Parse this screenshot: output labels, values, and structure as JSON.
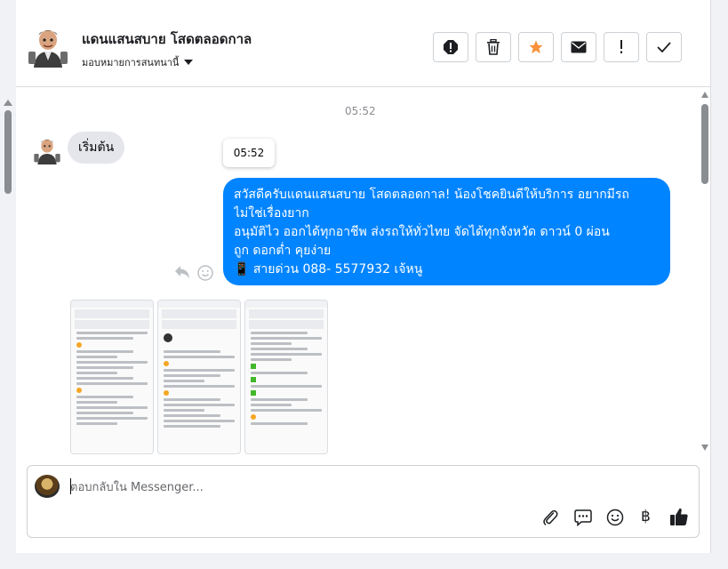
{
  "header": {
    "title": "แดนแสนสบาย โสดตลอดกาล",
    "assign_label": "มอบหมายการสนทนานี้",
    "actions": [
      {
        "name": "report-spam-button",
        "icon": "alert-octagon-icon"
      },
      {
        "name": "delete-button",
        "icon": "trash-icon"
      },
      {
        "name": "star-button",
        "icon": "star-icon"
      },
      {
        "name": "mark-unread-button",
        "icon": "envelope-icon"
      },
      {
        "name": "follow-up-button",
        "icon": "exclamation-icon"
      },
      {
        "name": "mark-done-button",
        "icon": "check-icon"
      }
    ]
  },
  "colors": {
    "accent": "#0084ff",
    "star": "#f7923a",
    "incoming_bubble": "#e4e6eb",
    "like": "#1c1e21"
  },
  "chat": {
    "timestamp": "05:52",
    "incoming_message": "เริ่มต้น",
    "tooltip_time": "05:52",
    "outgoing_lines": [
      "สวัสดีครับแดนแสนสบาย โสดตลอดกาล! น้องโชคยินดีให้บริการ อยากมีรถ",
      "ไม่ใช่เรื่องยาก",
      "อนุมัติไว ออกได้ทุกอาชีพ ส่งรถให้ทั่วไทย จัดได้ทุกจังหวัด ดาวน์ 0  ผ่อน",
      "ถูก ดอกต่ำ คุยง่าย",
      "📱 สายด่วน 088- 5577932 เจ้หนู"
    ],
    "attachments": [
      {
        "name": "attachment-image-1"
      },
      {
        "name": "attachment-image-2"
      },
      {
        "name": "attachment-image-3"
      }
    ]
  },
  "composer": {
    "placeholder": "ตอบกลับใน Messenger...",
    "value": "",
    "tools": [
      {
        "name": "attach-icon"
      },
      {
        "name": "saved-replies-icon"
      },
      {
        "name": "emoji-icon"
      },
      {
        "name": "payment-baht-icon"
      },
      {
        "name": "like-icon"
      }
    ],
    "baht_symbol": "฿"
  }
}
